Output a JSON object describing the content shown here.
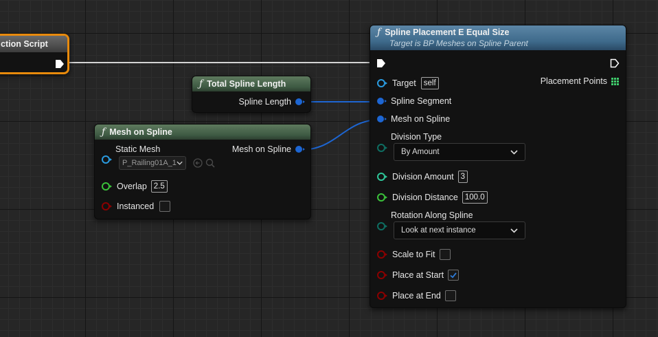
{
  "construction_node": {
    "title_fragment": "ction Script"
  },
  "total_spline_length_node": {
    "title": "Total Spline Length",
    "output_label": "Spline Length"
  },
  "mesh_on_spline_node": {
    "title": "Mesh on Spline",
    "static_mesh_label": "Static Mesh",
    "static_mesh_value": "P_Railing01A_1",
    "output_label": "Mesh on Spline",
    "overlap_label": "Overlap",
    "overlap_value": "2.5",
    "instanced_label": "Instanced"
  },
  "placement_node": {
    "title": "Spline Placement E Equal Size",
    "subtitle": "Target is BP Meshes on Spline Parent",
    "target_label": "Target",
    "target_value": "self",
    "placement_points_label": "Placement Points",
    "spline_segment_label": "Spline Segment",
    "mesh_on_spline_label": "Mesh on Spline",
    "division_type_label": "Division Type",
    "division_type_value": "By Amount",
    "division_amount_label": "Division Amount",
    "division_amount_value": "3",
    "division_distance_label": "Division Distance",
    "division_distance_value": "100.0",
    "rotation_label": "Rotation Along Spline",
    "rotation_value": "Look at next instance",
    "scale_to_fit_label": "Scale to Fit",
    "scale_to_fit_checked": false,
    "place_at_start_label": "Place at Start",
    "place_at_start_checked": true,
    "place_at_end_label": "Place at End",
    "place_at_end_checked": false
  },
  "colors": {
    "object_pin": "#1d66d3",
    "self_pin": "#2a9be0",
    "float_pin": "#3bc23b",
    "int_pin": "#2fc79a",
    "enum_pin": "#0e6e62",
    "bool_pin": "#8c0000",
    "exec_wire": "#d4d4d4",
    "selection_outline": "#e88a0c",
    "checkbox_check": "#2e7bd8"
  }
}
